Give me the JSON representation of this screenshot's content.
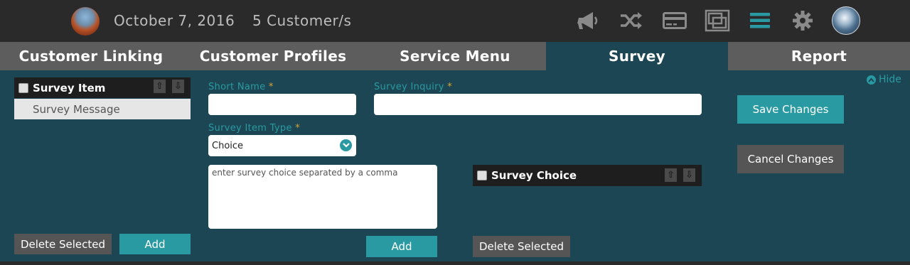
{
  "header": {
    "date": "October 7, 2016",
    "customers": "5 Customer/s",
    "icons": [
      "megaphone-icon",
      "shuffle-icon",
      "credit-card-icon",
      "window-icon",
      "menu-icon",
      "gear-icon"
    ],
    "accent_color": "#2a9aa2"
  },
  "tabs": [
    {
      "label": "Customer Linking"
    },
    {
      "label": "Customer Profiles"
    },
    {
      "label": "Service Menu"
    },
    {
      "label": "Survey",
      "active": true
    },
    {
      "label": "Report"
    }
  ],
  "hide_label": "Hide",
  "survey_items": {
    "header": "Survey Item",
    "items": [
      "Survey Message"
    ],
    "delete_label": "Delete Selected",
    "add_label": "Add"
  },
  "form": {
    "short_name_label": "Short Name",
    "short_name_value": "",
    "survey_inquiry_label": "Survey Inquiry",
    "survey_inquiry_value": "",
    "item_type_label": "Survey Item Type",
    "item_type_value": "Choice",
    "required_mark": "*",
    "choice_placeholder": "enter survey choice separated by a comma",
    "add_label": "Add"
  },
  "survey_choices": {
    "header": "Survey Choice",
    "delete_label": "Delete Selected"
  },
  "actions": {
    "save_label": "Save Changes",
    "cancel_label": "Cancel Changes"
  }
}
